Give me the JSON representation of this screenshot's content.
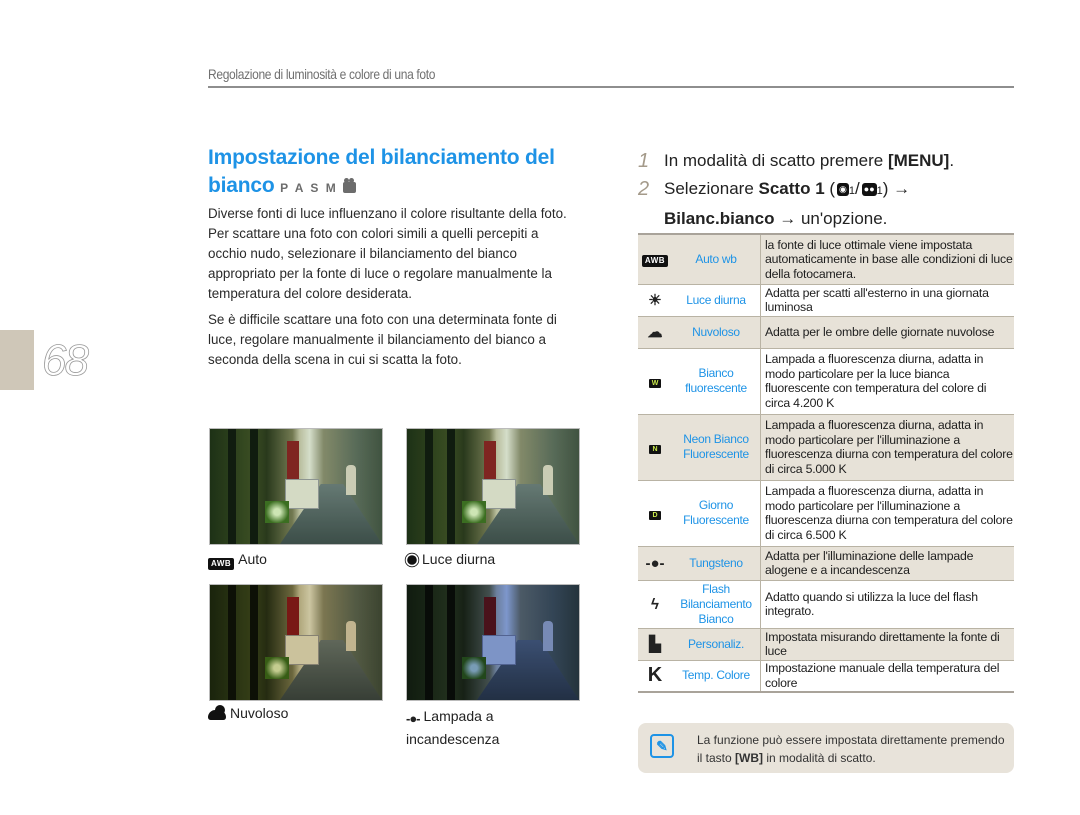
{
  "header": {
    "section_title": "Regolazione di luminosità e colore di una foto"
  },
  "page": {
    "number": "68"
  },
  "title": {
    "text": "Impostazione del bilanciamento del bianco",
    "modes": "P A S M"
  },
  "intro": {
    "paragraphs": [
      "Diverse fonti di luce influenzano il colore risultante della foto. Per scattare una foto con colori simili a quelli percepiti a occhio nudo, selezionare il bilanciamento del bianco appropriato per la fonte di luce o regolare manualmente la temperatura del colore desiderata.",
      "Se è difficile scattare una foto con una determinata fonte di luce, regolare manualmente il bilanciamento del bianco a seconda della scena in cui si scatta la foto."
    ]
  },
  "photos": [
    {
      "caption": "Auto",
      "icon": "awb-icon",
      "icon_text": "AWB"
    },
    {
      "caption": "Luce diurna",
      "icon": "sun-icon"
    },
    {
      "caption": "Nuvoloso",
      "icon": "cloud-icon"
    },
    {
      "caption": "Lampada a incandescenza",
      "icon": "tungsten-icon"
    }
  ],
  "steps": [
    {
      "num": "1",
      "pre": "In modalità di scatto premere ",
      "bold": "[MENU]",
      "post": "."
    },
    {
      "num": "2",
      "pre": "Selezionare ",
      "bold": "Scatto 1",
      "mid": " (",
      "cam1": "1",
      "sep": "/",
      "cam2": "1",
      "after": ") →",
      "bold2": "Bilanc.bianco",
      "post": " → un'opzione."
    }
  ],
  "wb_options": [
    {
      "icon": "awb-icon",
      "icon_text": "AWB",
      "name": "Auto wb",
      "desc": "la fonte di luce ottimale viene impostata automaticamente in base alle condizioni di luce della fotocamera.",
      "shaded": true
    },
    {
      "icon": "sun-icon",
      "icon_text": "☀",
      "name": "Luce diurna",
      "desc": "Adatta per scatti all'esterno in una giornata luminosa",
      "shaded": false
    },
    {
      "icon": "cloud-icon",
      "icon_text": "☁",
      "name": "Nuvoloso",
      "desc": "Adatta per le ombre delle giornate nuvolose",
      "shaded": true
    },
    {
      "icon": "fluorescent-w-icon",
      "icon_text": "W",
      "name": "Bianco fluorescente",
      "desc": "Lampada a fluorescenza diurna, adatta in modo particolare per la luce bianca fluorescente con temperatura del colore di circa 4.200 K",
      "shaded": false
    },
    {
      "icon": "fluorescent-n-icon",
      "icon_text": "N",
      "name": "Neon Bianco Fluorescente",
      "desc": "Lampada a fluorescenza diurna, adatta in modo particolare per l'illuminazione a fluorescenza diurna con temperatura del colore di circa 5.000 K",
      "shaded": true
    },
    {
      "icon": "fluorescent-d-icon",
      "icon_text": "D",
      "name": "Giorno Fluorescente",
      "desc": "Lampada a fluorescenza diurna, adatta in modo particolare per l'illuminazione a fluorescenza diurna con temperatura del colore di circa 6.500 K",
      "shaded": false
    },
    {
      "icon": "tungsten-icon",
      "icon_text": "-●-",
      "name": "Tungsteno",
      "desc": "Adatta per l'illuminazione delle lampade alogene e a incandescenza",
      "shaded": true
    },
    {
      "icon": "flash-icon",
      "icon_text": "ϟ",
      "name": "Flash Bilanciamento Bianco",
      "desc": "Adatto quando si utilizza la luce del flash integrato.",
      "shaded": false
    },
    {
      "icon": "custom-wb-icon",
      "icon_text": "▙",
      "name": "Personaliz.",
      "desc": "Impostata misurando direttamente la fonte di luce",
      "shaded": true
    },
    {
      "icon": "kelvin-icon",
      "icon_text": "K",
      "name": "Temp. Colore",
      "desc": "Impostazione manuale della temperatura del colore",
      "shaded": false
    }
  ],
  "tip": {
    "pre": "La funzione può essere impostata direttamente premendo il tasto ",
    "key": "[WB]",
    "post": " in modalità di scatto."
  },
  "colors": {
    "accent": "#1e93e6",
    "tab": "#cfc7b8",
    "shade": "#e7e2d8"
  }
}
